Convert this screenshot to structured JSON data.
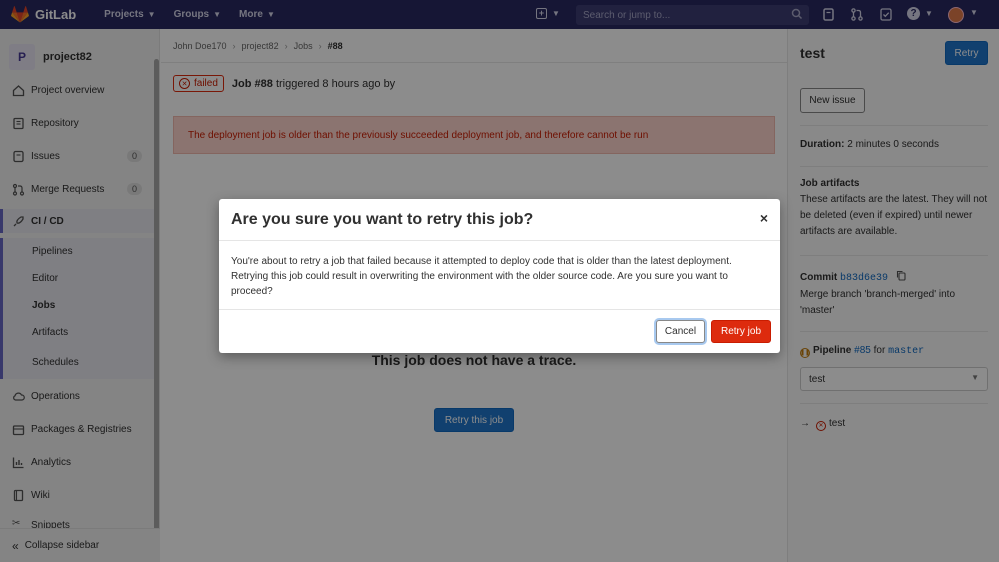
{
  "navbar": {
    "brand": "GitLab",
    "menu": [
      {
        "label": "Projects"
      },
      {
        "label": "Groups"
      },
      {
        "label": "More"
      }
    ],
    "search_placeholder": "Search or jump to..."
  },
  "sidebar": {
    "project_initial": "P",
    "project_name": "project82",
    "items": [
      {
        "label": "Project overview"
      },
      {
        "label": "Repository"
      },
      {
        "label": "Issues",
        "count": "0"
      },
      {
        "label": "Merge Requests",
        "count": "0"
      },
      {
        "label": "CI / CD"
      },
      {
        "label": "Operations"
      },
      {
        "label": "Packages & Registries"
      },
      {
        "label": "Analytics"
      },
      {
        "label": "Wiki"
      },
      {
        "label": "Snippets"
      }
    ],
    "cicd_sub": [
      {
        "label": "Pipelines"
      },
      {
        "label": "Editor"
      },
      {
        "label": "Jobs"
      },
      {
        "label": "Artifacts"
      },
      {
        "label": "Schedules"
      }
    ],
    "collapse_label": "Collapse sidebar"
  },
  "breadcrumb": [
    "John Doe170",
    "project82",
    "Jobs",
    "#88"
  ],
  "job": {
    "status": "failed",
    "title": "Job #88",
    "triggered_text": "triggered 8 hours ago by",
    "alert": "The deployment job is older than the previously succeeded deployment job, and therefore cannot be run",
    "no_trace": "This job does not have a trace.",
    "retry_this_label": "Retry this job"
  },
  "right_sidebar": {
    "title": "test",
    "retry_label": "Retry",
    "new_issue_label": "New issue",
    "duration_label": "Duration:",
    "duration_value": "2 minutes 0 seconds",
    "artifacts_title": "Job artifacts",
    "artifacts_text": "These artifacts are the latest. They will not be deleted (even if expired) until newer artifacts are available.",
    "commit_label": "Commit",
    "commit_sha": "b83d6e39",
    "commit_message": "Merge branch 'branch-merged' into 'master'",
    "pipeline_label": "Pipeline",
    "pipeline_id": "#85",
    "pipeline_for": "for",
    "pipeline_ref": "master",
    "stage_select": "test",
    "job_link": "test"
  },
  "modal": {
    "title": "Are you sure you want to retry this job?",
    "close": "×",
    "body": "You're about to retry a job that failed because it attempted to deploy code that is older than the latest deployment. Retrying this job could result in overwriting the environment with the older source code. Are you sure you want to proceed?",
    "cancel_label": "Cancel",
    "retry_label": "Retry job"
  },
  "colors": {
    "navbar": "#292961",
    "danger": "#dd2b0e",
    "primary": "#1f75cb"
  }
}
